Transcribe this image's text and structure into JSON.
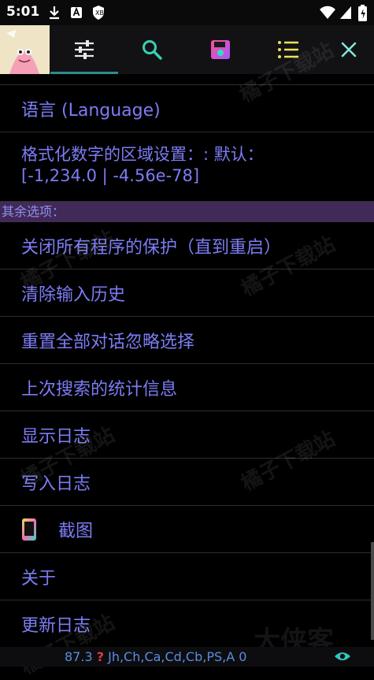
{
  "status": {
    "time": "5:01"
  },
  "toolbar": {
    "tabs": [
      "settings-tab",
      "search-tab",
      "save-tab",
      "list-tab"
    ],
    "close_label": "×"
  },
  "items": {
    "language": "语言 (Language)",
    "locale_line1": "格式化数字的区域设置：: 默认：",
    "locale_line2": "[-1,234.0 | -4.56e-78]",
    "section_other": "其余选项：",
    "close_protection": "关闭所有程序的保护（直到重启）",
    "clear_history": "清除输入历史",
    "reset_dialogs": "重置全部对话忽略选择",
    "search_stats": "上次搜索的统计信息",
    "show_log": "显示日志",
    "write_log": "写入日志",
    "screenshot": "截图",
    "about": "关于",
    "changelog": "更新日志"
  },
  "bottom": {
    "number": "87.3",
    "flag": "?",
    "codes": "Jh,Ch,Ca,Cd,Cb,PS,A 0"
  },
  "watermarks": [
    "橘子下载站",
    "大侠客"
  ],
  "colors": {
    "text": "#7c7cf5",
    "section_bg": "#412a57",
    "accent": "#2a8f8f"
  }
}
